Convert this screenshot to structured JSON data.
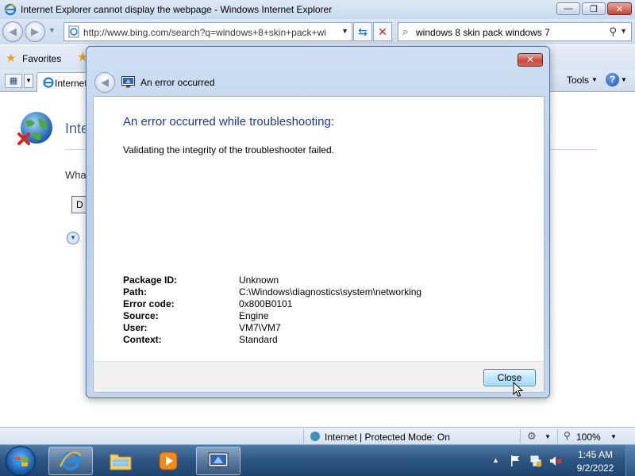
{
  "window": {
    "title": "Internet Explorer cannot display the webpage - Windows Internet Explorer",
    "minimize_glyph": "—",
    "maximize_glyph": "❐",
    "close_glyph": "✕"
  },
  "address_bar": {
    "url": "http://www.bing.com/search?q=windows+8+skin+pack+wi",
    "search_value": "windows 8 skin pack windows 7"
  },
  "favorites_bar": {
    "favorites_label": "Favorites"
  },
  "tab_bar": {
    "current_tab_label": "Internet",
    "tools_label": "Tools",
    "help_glyph": "?"
  },
  "page": {
    "heading": "Inte",
    "question": "Wha",
    "diagnose_button_label": "D"
  },
  "status_bar": {
    "zone_text": "Internet | Protected Mode: On",
    "zoom_text": "100%"
  },
  "taskbar": {
    "clock_time": "1:45 AM",
    "clock_date": "9/2/2022"
  },
  "dialog": {
    "title": "An error occurred",
    "heading": "An error occurred while troubleshooting:",
    "message": "Validating the integrity of the troubleshooter failed.",
    "details": [
      {
        "label": "Package ID:",
        "value": "Unknown"
      },
      {
        "label": "Path:",
        "value": "C:\\Windows\\diagnostics\\system\\networking"
      },
      {
        "label": "Error code:",
        "value": "0x800B0101"
      },
      {
        "label": "Source:",
        "value": "Engine"
      },
      {
        "label": "User:",
        "value": "VM7\\VM7"
      },
      {
        "label": "Context:",
        "value": "Standard"
      }
    ],
    "close_button_label": "Close",
    "close_glyph": "✕"
  },
  "colors": {
    "dialog_heading": "#1e3b87",
    "taskbar": "#2f5784",
    "accent_button": "#a7d9f5"
  },
  "icons": [
    "ie-app-icon",
    "back-icon",
    "forward-icon",
    "refresh-icon",
    "stop-icon",
    "search-icon",
    "favorites-star-icon",
    "globe-error-icon",
    "troubleshooter-icon",
    "start-orb-icon",
    "action-center-flag-icon",
    "network-icon",
    "volume-muted-icon"
  ]
}
